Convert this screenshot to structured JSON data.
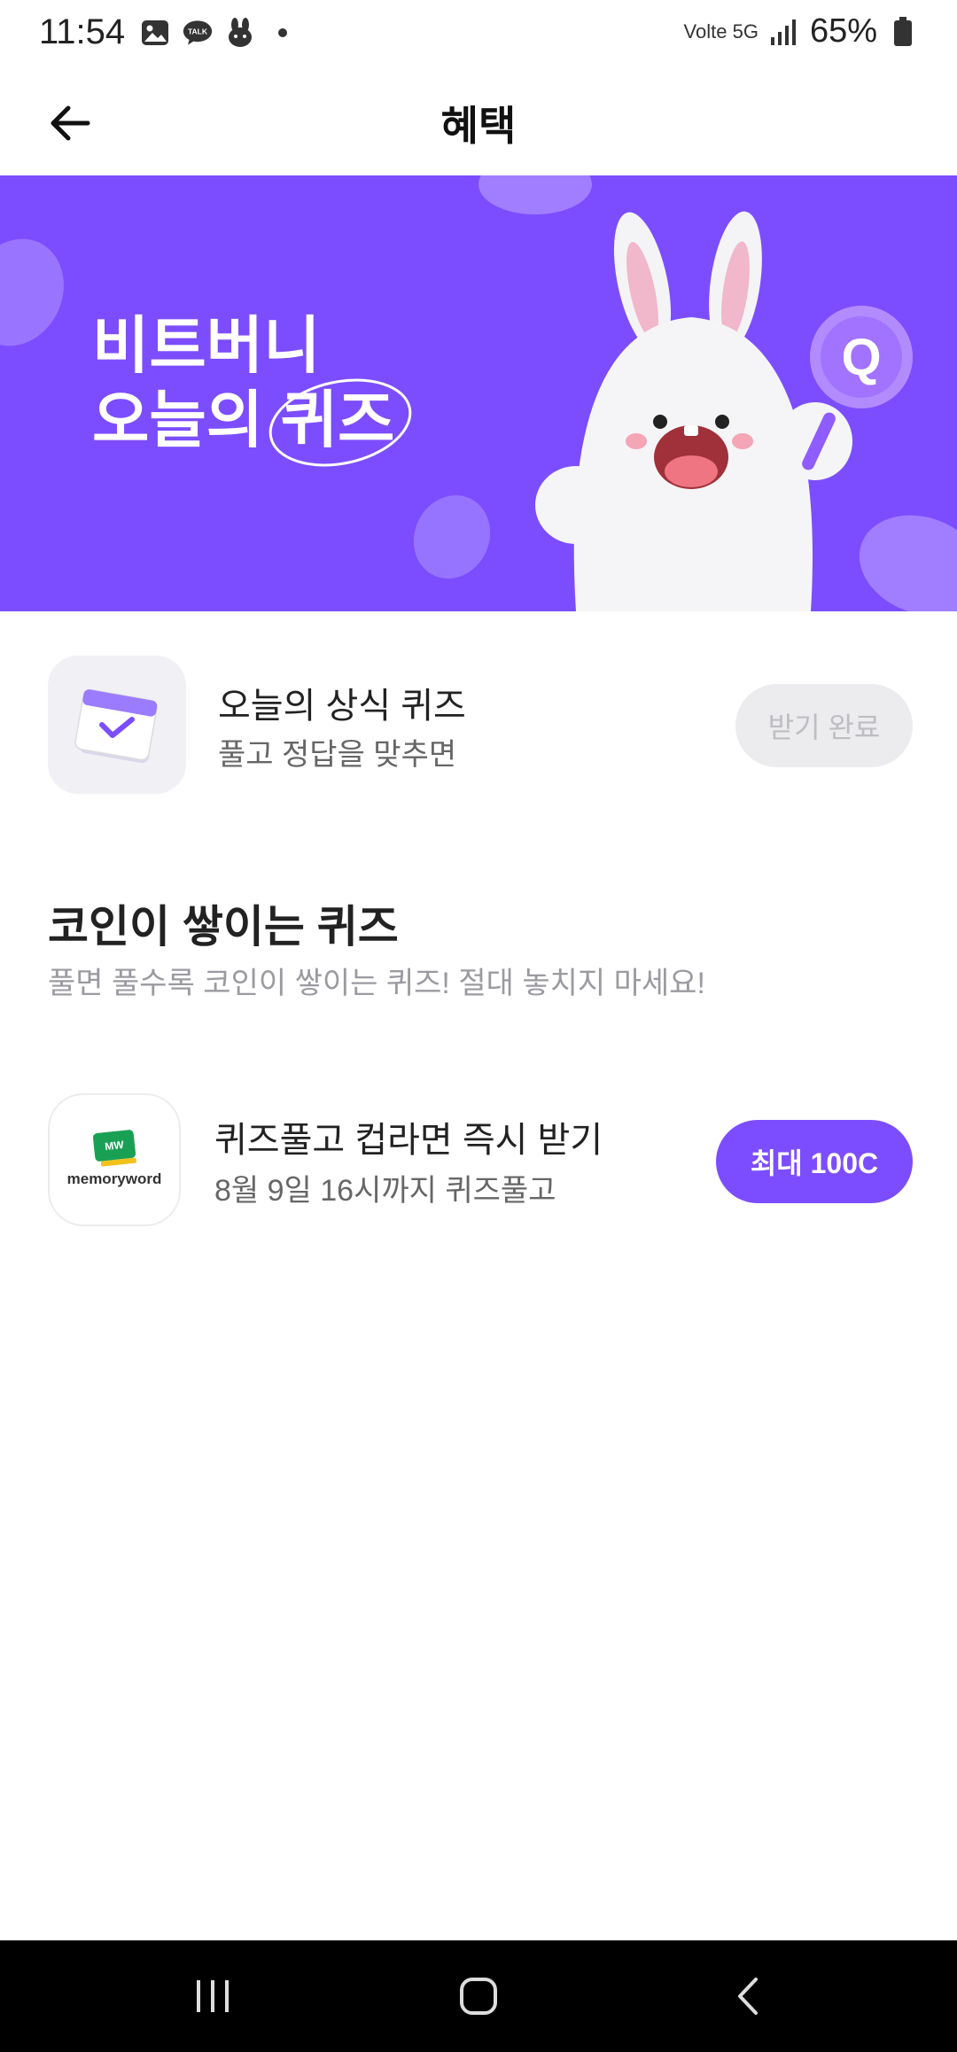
{
  "status_bar": {
    "time": "11:54",
    "network": "Volte 5G",
    "battery": "65%",
    "talk_badge": "TALK"
  },
  "header": {
    "title": "혜택",
    "back_icon": "arrow-left-icon"
  },
  "banner": {
    "line1": "비트버니",
    "line2_prefix": "오늘의",
    "line2_highlight": "퀴즈",
    "quiz_sign": "Q",
    "background": "#7c4dff"
  },
  "daily_quiz": {
    "title": "오늘의 상식 퀴즈",
    "subtitle": "풀고 정답을 맞추면",
    "button_label": "받기 완료",
    "icon": "calendar-check-icon"
  },
  "coin_quiz_section": {
    "title": "코인이 쌓이는 퀴즈",
    "subtitle": "풀면 풀수록 코인이 쌓이는 퀴즈! 절대 놓치지 마세요!"
  },
  "quiz_items": [
    {
      "brand_mark": "MW",
      "brand": "memoryword",
      "title": "퀴즈풀고 컵라면 즉시 받기",
      "subtitle": "8월 9일 16시까지 퀴즈풀고",
      "button_label": "최대 100C"
    }
  ],
  "colors": {
    "accent": "#7c4dff",
    "disabled_button": "#ececef",
    "disabled_text": "#bdbdc2"
  }
}
